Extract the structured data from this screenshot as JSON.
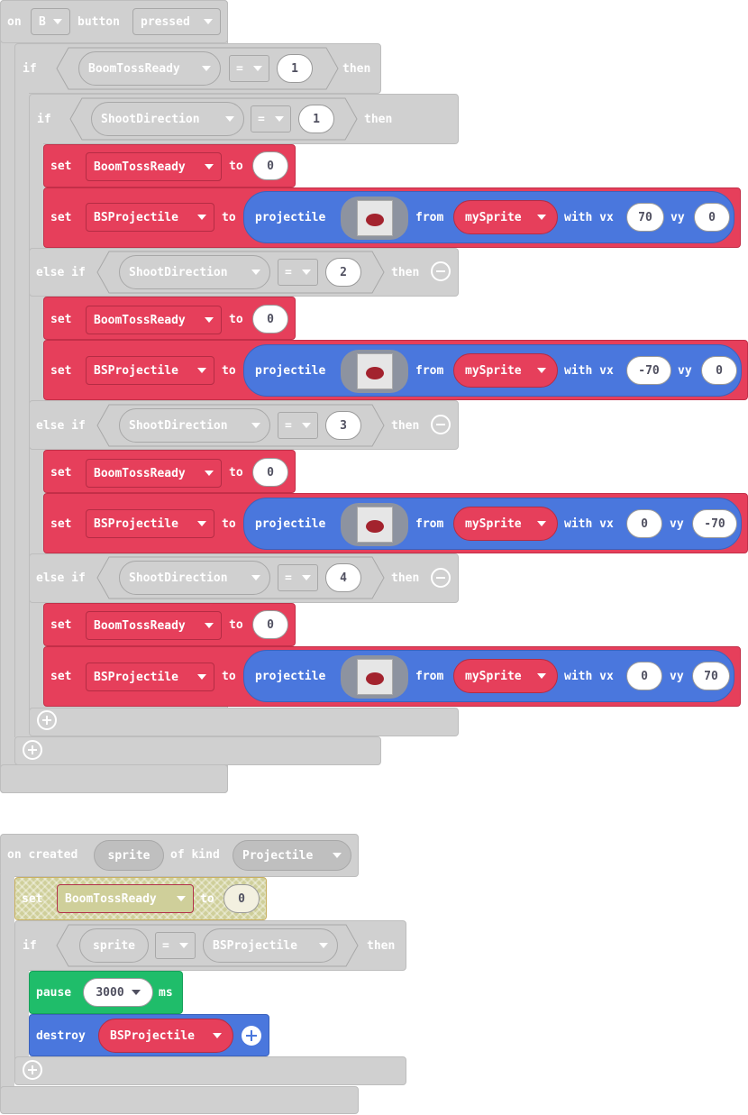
{
  "event1": {
    "on": "on",
    "button": "B",
    "button_word": "button",
    "action": "pressed",
    "if_kw": "if",
    "then_kw": "then",
    "else_if_kw": "else if",
    "outer_var": "BoomTossReady",
    "outer_op": "=",
    "outer_val": "1",
    "inner_var": "ShootDirection",
    "inner_op": "=",
    "branches": [
      {
        "dir": "1",
        "set_var": "BoomTossReady",
        "set_val": "0",
        "proj_var": "BSProjectile",
        "from": "mySprite",
        "vx": "70",
        "vy": "0"
      },
      {
        "dir": "2",
        "set_var": "BoomTossReady",
        "set_val": "0",
        "proj_var": "BSProjectile",
        "from": "mySprite",
        "vx": "-70",
        "vy": "0"
      },
      {
        "dir": "3",
        "set_var": "BoomTossReady",
        "set_val": "0",
        "proj_var": "BSProjectile",
        "from": "mySprite",
        "vx": "0",
        "vy": "-70"
      },
      {
        "dir": "4",
        "set_var": "BoomTossReady",
        "set_val": "0",
        "proj_var": "BSProjectile",
        "from": "mySprite",
        "vx": "0",
        "vy": "70"
      }
    ],
    "set_kw": "set",
    "to_kw": "to",
    "projectile_kw": "projectile",
    "from_kw": "from",
    "with_vx_kw": "with vx",
    "vy_kw": "vy"
  },
  "event2": {
    "on_created": "on created",
    "sprite": "sprite",
    "of_kind": "of kind",
    "kind": "Projectile",
    "set_kw": "set",
    "set_var": "BoomTossReady",
    "to_kw": "to",
    "set_val": "0",
    "if_kw": "if",
    "cond_left": "sprite",
    "cond_op": "=",
    "cond_right": "BSProjectile",
    "then_kw": "then",
    "pause_kw": "pause",
    "pause_val": "3000",
    "ms_kw": "ms",
    "destroy_kw": "destroy",
    "destroy_var": "BSProjectile"
  },
  "colors": {
    "variables": "#e63f5b",
    "sprites": "#4a77dd",
    "loops": "#1fbd6a",
    "disabled": "#d0d0d0"
  },
  "icons": [
    "dropdown-arrow-icon",
    "add-branch-icon",
    "remove-branch-icon",
    "projectile-image-icon"
  ]
}
